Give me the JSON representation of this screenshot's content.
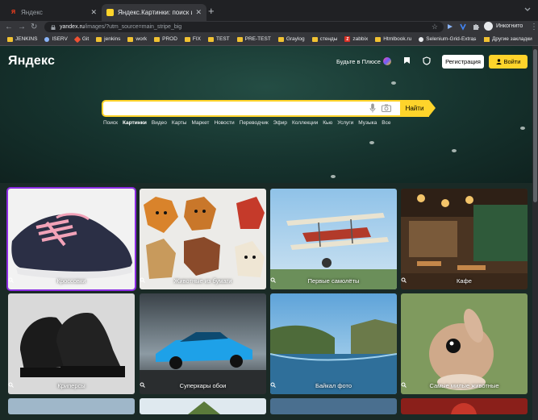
{
  "browser": {
    "tabs": [
      {
        "title": "Яндекс",
        "active": false
      },
      {
        "title": "Яндекс.Картинки: поиск изобра",
        "active": true
      }
    ],
    "url_domain": "yandex.ru",
    "url_path": "/images/?utm_source=main_stripe_big",
    "incognito_label": "Инкогнито",
    "bookmarks": [
      {
        "label": "JENKINS",
        "icon": "folder-icon"
      },
      {
        "label": "ISERV",
        "icon": "globe-icon"
      },
      {
        "label": "Git",
        "icon": "git-icon"
      },
      {
        "label": "jenkins",
        "icon": "folder-icon"
      },
      {
        "label": "work",
        "icon": "folder-icon"
      },
      {
        "label": "PROD",
        "icon": "folder-icon"
      },
      {
        "label": "FIX",
        "icon": "folder-icon"
      },
      {
        "label": "TEST",
        "icon": "folder-icon"
      },
      {
        "label": "PRE-TEST",
        "icon": "folder-icon"
      },
      {
        "label": "Graylog",
        "icon": "folder-icon"
      },
      {
        "label": "стенды",
        "icon": "folder-icon"
      },
      {
        "label": "zabbix",
        "icon": "zabbix-icon"
      },
      {
        "label": "Htmlbook.ru",
        "icon": "folder-icon"
      },
      {
        "label": "Selenium-Grid-Extras",
        "icon": "github-icon"
      }
    ],
    "bookmarks_more": "»",
    "other_bookmarks": "Другие закладки"
  },
  "header": {
    "logo": "Яндекс",
    "plus_label": "Будьте в Плюсе",
    "register_label": "Регистрация",
    "login_label": "Войти"
  },
  "search": {
    "value": "",
    "button_label": "Найти"
  },
  "services": [
    "Поиск",
    "Картинки",
    "Видео",
    "Карты",
    "Маркет",
    "Новости",
    "Переводчик",
    "Эфир",
    "Коллекции",
    "Кью",
    "Услуги",
    "Музыка",
    "Все"
  ],
  "active_service": "Картинки",
  "tiles": [
    {
      "caption": "Кроссовки"
    },
    {
      "caption": "Животные из бумаги"
    },
    {
      "caption": "Первые самолёты"
    },
    {
      "caption": "Кафе"
    },
    {
      "caption": "Криперсы"
    },
    {
      "caption": "Суперкары обои"
    },
    {
      "caption": "Байкал фото"
    },
    {
      "caption": "Самые милые животные"
    }
  ],
  "colors": {
    "accent": "#fed42b",
    "selection": "#8a2be2"
  }
}
